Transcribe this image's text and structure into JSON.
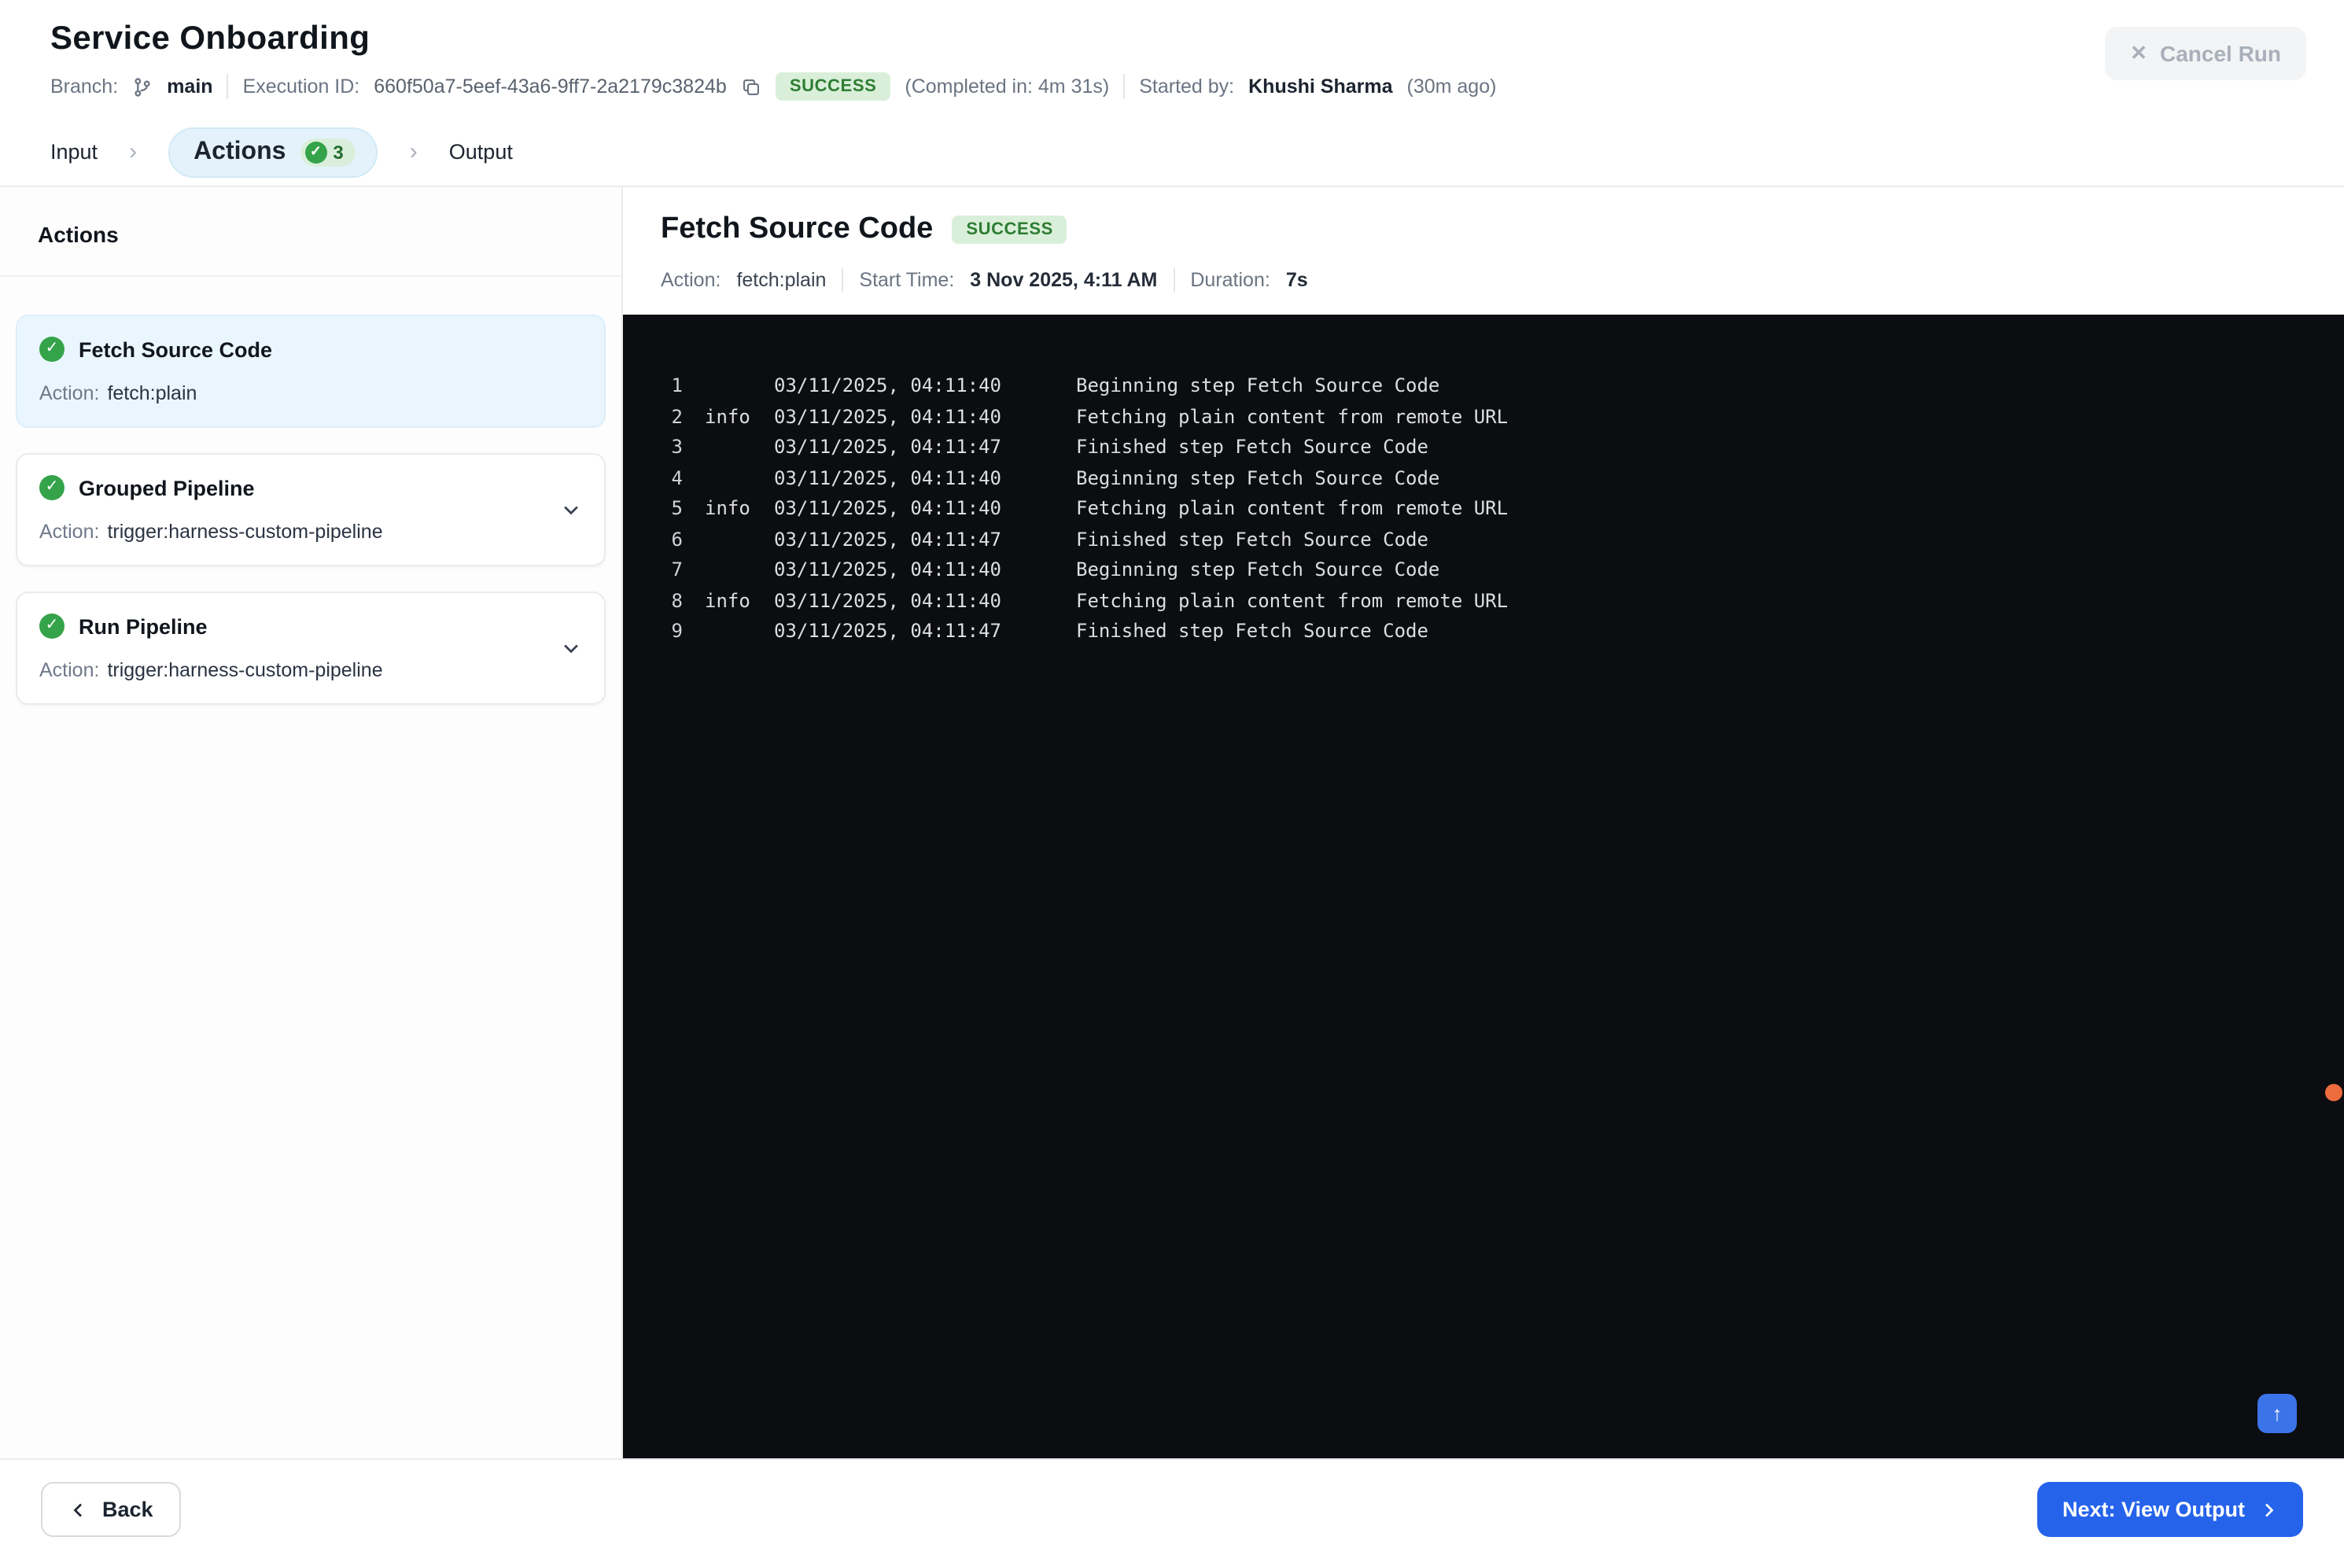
{
  "header": {
    "title": "Service Onboarding",
    "branch_label": "Branch:",
    "branch": "main",
    "execution_id_label": "Execution ID:",
    "execution_id": "660f50a7-5eef-43a6-9ff7-2a2179c3824b",
    "status": "SUCCESS",
    "completed_in": "(Completed in: 4m 31s)",
    "started_by_label": "Started by:",
    "started_by": "Khushi Sharma",
    "started_ago": "(30m ago)",
    "cancel_x": "✕",
    "cancel_label": "Cancel Run"
  },
  "stepper": {
    "input_label": "Input",
    "actions_label": "Actions",
    "actions_check": "✓",
    "actions_count": "3",
    "output_label": "Output",
    "chevron": "›"
  },
  "sidebar": {
    "title": "Actions",
    "items": [
      {
        "check": "✓",
        "title": "Fetch Source Code",
        "action_label": "Action:",
        "action": "fetch:plain",
        "selected": true,
        "expandable": false
      },
      {
        "check": "✓",
        "title": "Grouped Pipeline",
        "action_label": "Action:",
        "action": "trigger:harness-custom-pipeline",
        "selected": false,
        "expandable": true
      },
      {
        "check": "✓",
        "title": "Run Pipeline",
        "action_label": "Action:",
        "action": "trigger:harness-custom-pipeline",
        "selected": false,
        "expandable": true
      }
    ]
  },
  "main": {
    "title": "Fetch Source Code",
    "status": "SUCCESS",
    "meta": {
      "action_label": "Action:",
      "action": "fetch:plain",
      "start_label": "Start Time:",
      "start": "3 Nov 2025, 4:11 AM",
      "duration_label": "Duration:",
      "duration": "7s"
    },
    "log": {
      "scroll_top": "↑",
      "lines": [
        {
          "num": "1",
          "level": "",
          "time": "03/11/2025, 04:11:40",
          "msg": "Beginning step Fetch Source Code"
        },
        {
          "num": "2",
          "level": "info",
          "time": "03/11/2025, 04:11:40",
          "msg": "Fetching plain content from remote URL"
        },
        {
          "num": "3",
          "level": "",
          "time": "03/11/2025, 04:11:47",
          "msg": "Finished step Fetch Source Code"
        },
        {
          "num": "4",
          "level": "",
          "time": "03/11/2025, 04:11:40",
          "msg": "Beginning step Fetch Source Code"
        },
        {
          "num": "5",
          "level": "info",
          "time": "03/11/2025, 04:11:40",
          "msg": "Fetching plain content from remote URL"
        },
        {
          "num": "6",
          "level": "",
          "time": "03/11/2025, 04:11:47",
          "msg": "Finished step Fetch Source Code"
        },
        {
          "num": "7",
          "level": "",
          "time": "03/11/2025, 04:11:40",
          "msg": "Beginning step Fetch Source Code"
        },
        {
          "num": "8",
          "level": "info",
          "time": "03/11/2025, 04:11:40",
          "msg": "Fetching plain content from remote URL"
        },
        {
          "num": "9",
          "level": "",
          "time": "03/11/2025, 04:11:47",
          "msg": "Finished step Fetch Source Code"
        }
      ]
    }
  },
  "footer": {
    "back_label": "Back",
    "next_label": "Next: View Output"
  },
  "colors": {
    "primary_blue": "#2563eb",
    "success_bg": "#d9efd9",
    "success_text": "#2e7d33",
    "console_bg": "#0c0d10",
    "selected_card_bg": "#eaf6fd"
  }
}
